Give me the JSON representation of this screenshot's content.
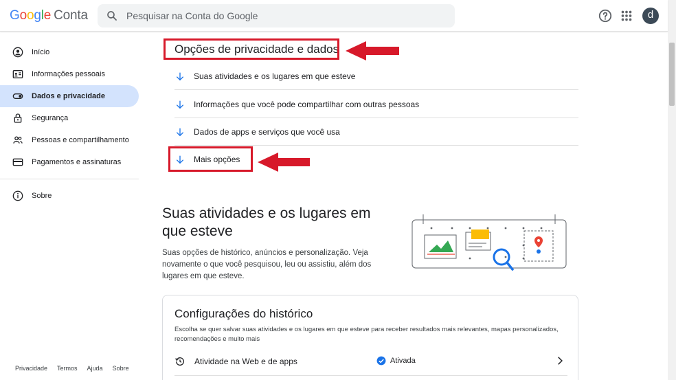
{
  "header": {
    "logo_google": "Google",
    "logo_conta": "Conta",
    "search_placeholder": "Pesquisar na Conta do Google",
    "avatar_letter": "d"
  },
  "sidebar": {
    "items": [
      {
        "label": "Início",
        "icon": "person-circle-icon"
      },
      {
        "label": "Informações pessoais",
        "icon": "id-card-icon"
      },
      {
        "label": "Dados e privacidade",
        "icon": "toggle-icon",
        "active": true
      },
      {
        "label": "Segurança",
        "icon": "lock-icon"
      },
      {
        "label": "Pessoas e compartilhamento",
        "icon": "people-icon"
      },
      {
        "label": "Pagamentos e assinaturas",
        "icon": "credit-card-icon"
      }
    ],
    "about": "Sobre",
    "footer": [
      "Privacidade",
      "Termos",
      "Ajuda",
      "Sobre"
    ]
  },
  "main": {
    "section_title": "Opções de privacidade e dados",
    "options": [
      "Suas atividades e os lugares em que esteve",
      "Informações que você pode compartilhar com outras pessoas",
      "Dados de apps e serviços que você usa",
      "Mais opções"
    ],
    "activity_title": "Suas atividades e os lugares em que esteve",
    "activity_desc": "Suas opções de histórico, anúncios e personalização. Veja novamente o que você pesquisou, leu ou assistiu, além dos lugares em que esteve.",
    "card": {
      "title": "Configurações do histórico",
      "desc": "Escolha se quer salvar suas atividades e os lugares em que esteve para receber resultados mais relevantes, mapas personalizados, recomendações e muito mais",
      "row_label": "Atividade na Web e de apps",
      "row_status": "Ativada"
    }
  },
  "colors": {
    "accent": "#1a73e8",
    "active_bg": "#d3e3fd",
    "annotation_red": "#d7192a"
  }
}
